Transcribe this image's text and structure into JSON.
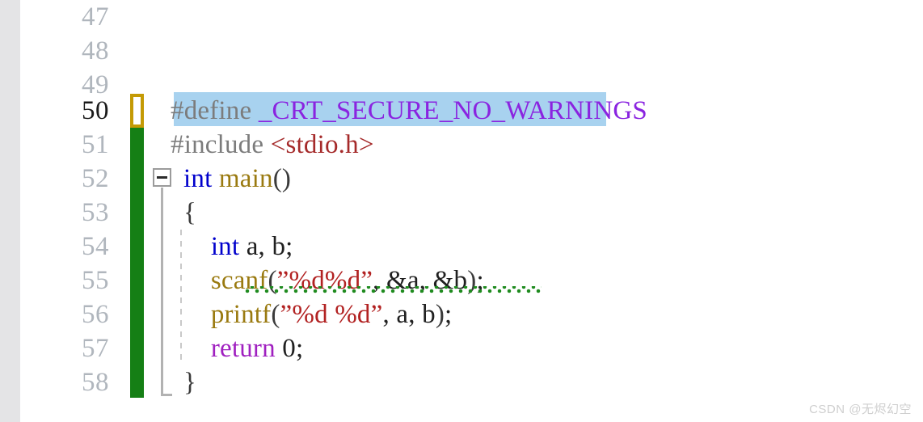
{
  "editor": {
    "gutter": {
      "line_numbers": [
        "47",
        "48",
        "49",
        "50",
        "51",
        "52",
        "53",
        "54",
        "55",
        "56",
        "57",
        "58"
      ],
      "current_line": "50",
      "fold_marker": "collapse-minus-icon"
    },
    "change_bar": {
      "pending_color": "#c49a05",
      "saved_color": "#157f15",
      "pending_lines": [
        "50"
      ],
      "saved_lines": [
        "51",
        "52",
        "53",
        "54",
        "55",
        "56",
        "57",
        "58"
      ]
    },
    "selection": {
      "color": "#a8d2ef",
      "line": "50",
      "text": "#define _CRT_SECURE_NO_WARNINGS"
    },
    "diagnostics": {
      "squiggle_color": "#1f8b1f",
      "line": "55",
      "span_text": "scanf(\"%d%d\", &a, &b)"
    },
    "lines": [
      {
        "number": "47",
        "tokens": []
      },
      {
        "number": "48",
        "tokens": []
      },
      {
        "number": "49",
        "tokens": []
      },
      {
        "number": "50",
        "tokens": [
          {
            "text": "#define ",
            "kind": "t-pre"
          },
          {
            "text": "_CRT_SECURE_NO_WARNINGS",
            "kind": "t-macro"
          }
        ]
      },
      {
        "number": "51",
        "tokens": [
          {
            "text": "#include ",
            "kind": "t-pre"
          },
          {
            "text": "<stdio.h>",
            "kind": "t-header"
          }
        ]
      },
      {
        "number": "52",
        "tokens": [
          {
            "text": "int",
            "kind": "t-kw"
          },
          {
            "text": " ",
            "kind": "t-plain"
          },
          {
            "text": "main",
            "kind": "t-fn"
          },
          {
            "text": "()",
            "kind": "t-punct"
          }
        ]
      },
      {
        "number": "53",
        "tokens": [
          {
            "text": "{",
            "kind": "t-punct"
          }
        ]
      },
      {
        "number": "54",
        "tokens": [
          {
            "text": "    ",
            "kind": "t-plain"
          },
          {
            "text": "int",
            "kind": "t-kw"
          },
          {
            "text": " a, b;",
            "kind": "t-plain"
          }
        ]
      },
      {
        "number": "55",
        "tokens": [
          {
            "text": "    ",
            "kind": "t-plain"
          },
          {
            "text": "scanf",
            "kind": "t-fn"
          },
          {
            "text": "(",
            "kind": "t-punct"
          },
          {
            "text": "”%d%d”",
            "kind": "t-str"
          },
          {
            "text": ", &a, &b",
            "kind": "t-plain"
          },
          {
            "text": ")",
            "kind": "t-punct"
          },
          {
            "text": ";",
            "kind": "t-plain"
          }
        ]
      },
      {
        "number": "56",
        "tokens": [
          {
            "text": "    ",
            "kind": "t-plain"
          },
          {
            "text": "printf",
            "kind": "t-fn"
          },
          {
            "text": "(",
            "kind": "t-punct"
          },
          {
            "text": "”%d %d”",
            "kind": "t-str"
          },
          {
            "text": ", a, b",
            "kind": "t-plain"
          },
          {
            "text": ")",
            "kind": "t-punct"
          },
          {
            "text": ";",
            "kind": "t-plain"
          }
        ]
      },
      {
        "number": "57",
        "tokens": [
          {
            "text": "    ",
            "kind": "t-plain"
          },
          {
            "text": "return",
            "kind": "t-ctl"
          },
          {
            "text": " 0;",
            "kind": "t-plain"
          }
        ]
      },
      {
        "number": "58",
        "tokens": [
          {
            "text": "}",
            "kind": "t-punct"
          }
        ]
      }
    ]
  },
  "watermark": {
    "text": "CSDN @无烬幻空"
  }
}
